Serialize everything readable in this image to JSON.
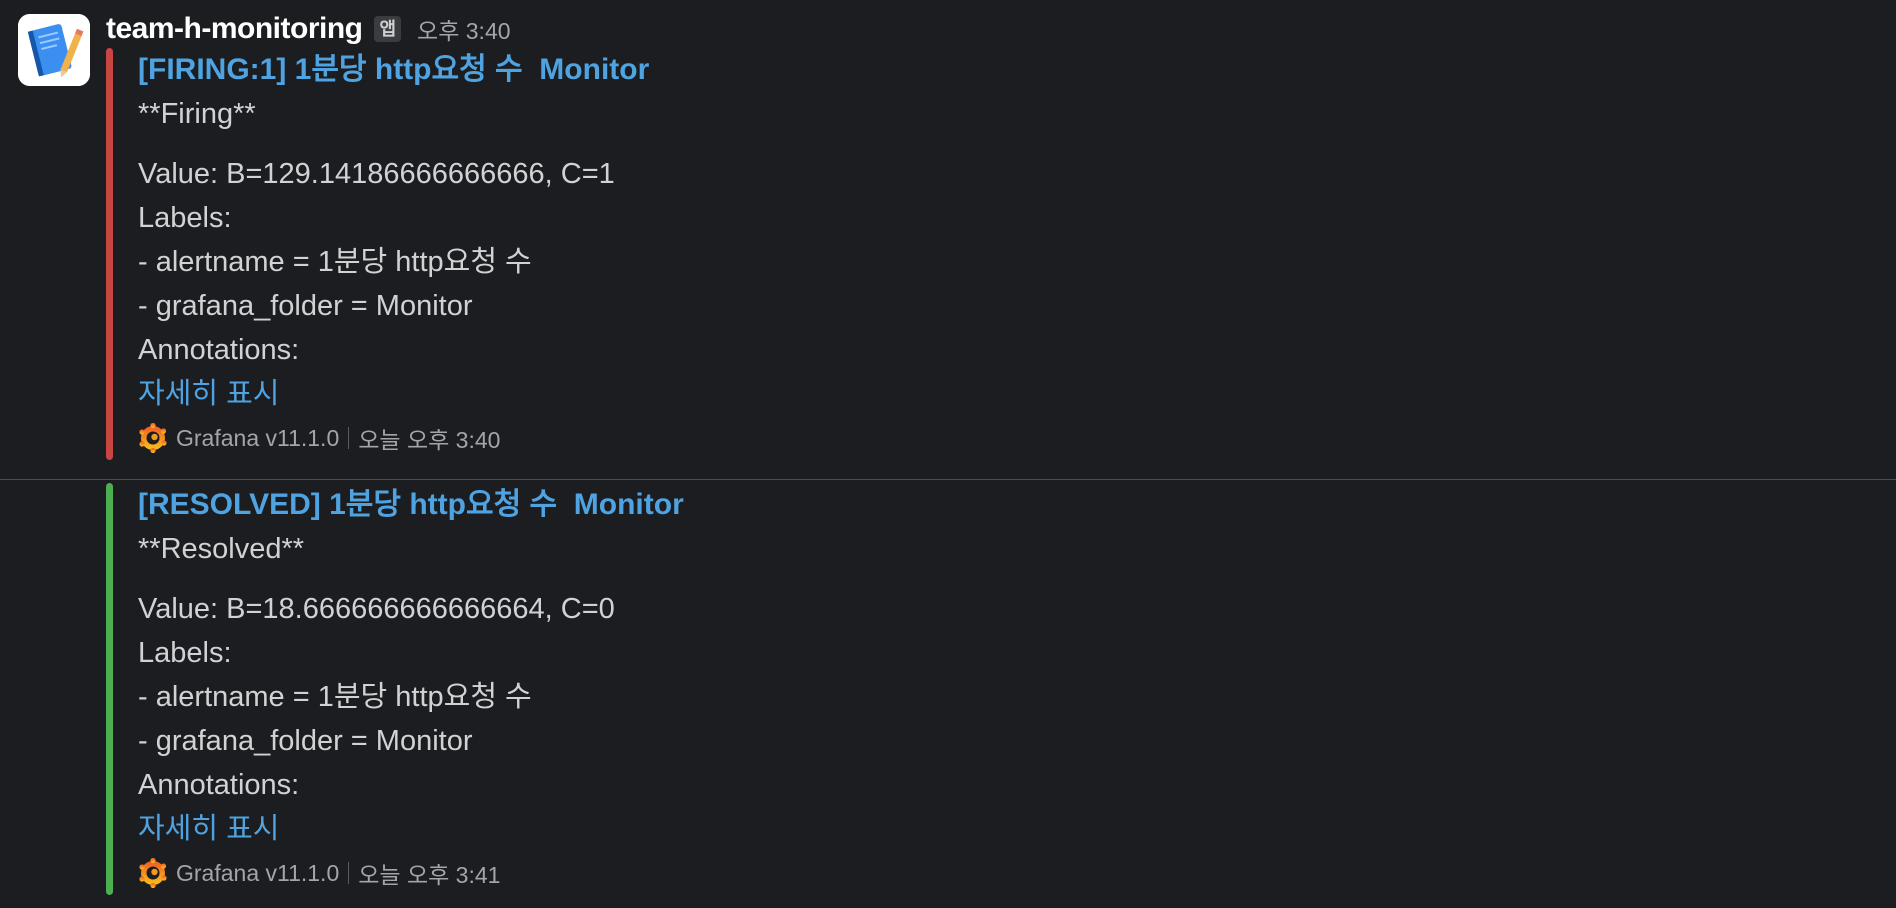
{
  "message": {
    "sender": "team-h-monitoring",
    "app_badge": "앱",
    "time": "오후 3:40"
  },
  "colors": {
    "firing_bar": "#c94542",
    "resolved_bar": "#4caf50",
    "link": "#4fa3e0",
    "background": "#1b1d21"
  },
  "firing": {
    "title": "[FIRING:1] 1분당 http요청 수  Monitor",
    "status": "**Firing**",
    "value": "Value: B=129.14186666666666, C=1",
    "labels_heading": "Labels:",
    "label_alertname": "- alertname = 1분당 http요청 수",
    "label_folder": "- grafana_folder = Monitor",
    "annotations_heading": "Annotations:",
    "show_more": "자세히 표시",
    "footer_source": "Grafana v11.1.0",
    "footer_time": "오늘 오후 3:40"
  },
  "resolved": {
    "title": "[RESOLVED] 1분당 http요청 수  Monitor",
    "status": "**Resolved**",
    "value": "Value: B=18.666666666666664, C=0",
    "labels_heading": "Labels:",
    "label_alertname": "- alertname = 1분당 http요청 수",
    "label_folder": "- grafana_folder = Monitor",
    "annotations_heading": "Annotations:",
    "show_more": "자세히 표시",
    "footer_source": "Grafana v11.1.0",
    "footer_time": "오늘 오후 3:41"
  },
  "icons": {
    "avatar": "notebook-icon",
    "footer": "grafana-logo-icon"
  }
}
